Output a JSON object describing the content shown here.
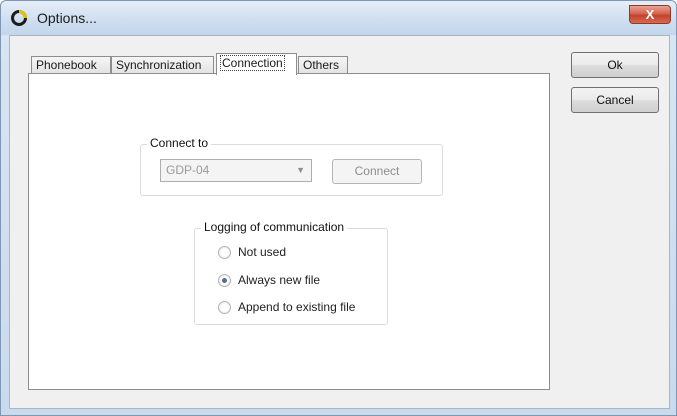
{
  "window": {
    "title": "Options...",
    "close_label": "X"
  },
  "tabs": [
    {
      "label": "Phonebook"
    },
    {
      "label": "Synchronization"
    },
    {
      "label": "Connection"
    },
    {
      "label": "Others"
    }
  ],
  "active_tab": "Connection",
  "buttons": {
    "ok": "Ok",
    "cancel": "Cancel"
  },
  "connection": {
    "group_label": "Connect to",
    "device_value": "GDP-04",
    "connect_button": "Connect"
  },
  "logging": {
    "group_label": "Logging of communication",
    "options": [
      {
        "label": "Not used",
        "checked": false
      },
      {
        "label": "Always new file",
        "checked": true
      },
      {
        "label": "Append to existing file",
        "checked": false
      }
    ]
  },
  "icons": {
    "app": "app-logo-icon",
    "close": "close-icon",
    "dropdown": "chevron-down-icon"
  },
  "colors": {
    "title_bar": "#cfdff0",
    "close_button": "#c2432c",
    "radio_selected": "#4f6f93"
  }
}
